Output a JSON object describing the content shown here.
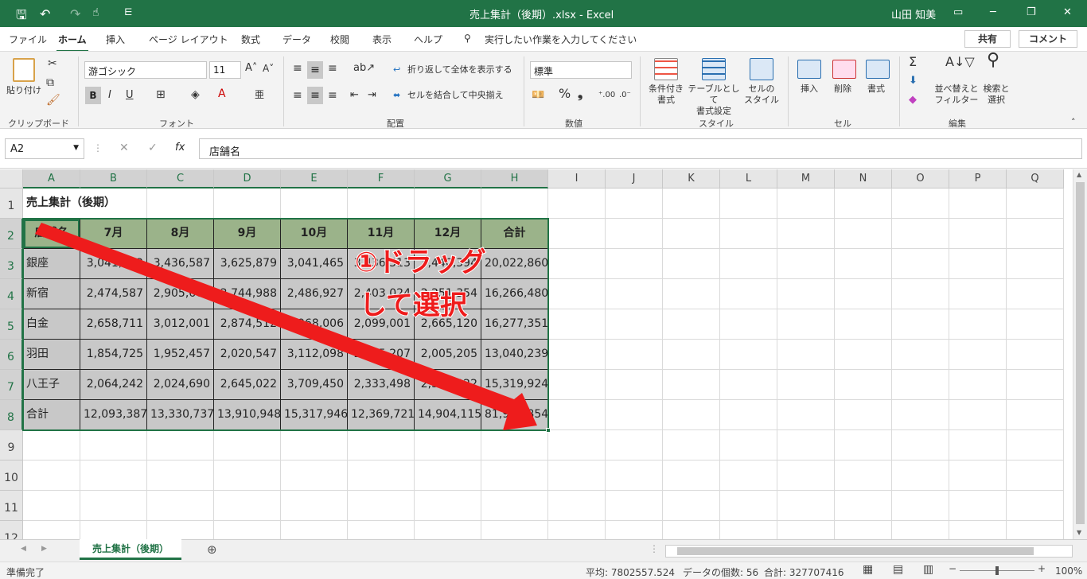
{
  "title_bar": {
    "title": "売上集計（後期）.xlsx  -  Excel",
    "user": "山田 知美"
  },
  "tabs": [
    "ファイル",
    "ホーム",
    "挿入",
    "ページ レイアウト",
    "数式",
    "データ",
    "校閲",
    "表示",
    "ヘルプ"
  ],
  "tell_me": "実行したい作業を入力してください",
  "share": "共有",
  "comment": "コメント",
  "ribbon": {
    "paste": "貼り付け",
    "clipboard": "クリップボード",
    "font_name": "游ゴシック",
    "font_size": "11",
    "font": "フォント",
    "wrap_text": "折り返して全体を表示する",
    "merge_center": "セルを結合して中央揃え",
    "alignment": "配置",
    "number_format": "標準",
    "number": "数値",
    "cond_format": "条件付き\n書式",
    "table_format": "テーブルとして\n書式設定",
    "cell_style": "セルの\nスタイル",
    "styles": "スタイル",
    "insert": "挿入",
    "delete": "削除",
    "format": "書式",
    "cells": "セル",
    "sort_filter": "並べ替えと\nフィルター",
    "find_select": "検索と\n選択",
    "editing": "編集"
  },
  "formula_bar": {
    "name_box": "A2",
    "fx": "fx",
    "content": "店舗名"
  },
  "columns": [
    "A",
    "B",
    "C",
    "D",
    "E",
    "F",
    "G",
    "H",
    "I",
    "J",
    "K",
    "L",
    "M",
    "N",
    "O",
    "P",
    "Q"
  ],
  "rows": [
    "1",
    "2",
    "3",
    "4",
    "5",
    "6",
    "7",
    "8",
    "9",
    "10",
    "11",
    "12"
  ],
  "sheet": {
    "title": "売上集計（後期）",
    "headers": [
      "店舗名",
      "7月",
      "8月",
      "9月",
      "10月",
      "11月",
      "12月",
      "合計"
    ],
    "data": [
      [
        "銀座",
        "3,041,122",
        "3,436,587",
        "3,625,879",
        "3,041,465",
        "3,436,513",
        "3,440,394",
        "20,022,860"
      ],
      [
        "新宿",
        "2,474,587",
        "2,905,600",
        "2,744,988",
        "2,486,927",
        "2,403,024",
        "2,251,354",
        "16,266,480"
      ],
      [
        "白金",
        "2,658,711",
        "3,012,001",
        "2,874,512",
        "2,968,006",
        "2,099,001",
        "2,665,120",
        "16,277,351"
      ],
      [
        "羽田",
        "1,854,725",
        "1,952,457",
        "2,020,547",
        "3,112,098",
        "2,095,207",
        "2,005,205",
        "13,040,239"
      ],
      [
        "八王子",
        "2,064,242",
        "2,024,690",
        "2,645,022",
        "3,709,450",
        "2,333,498",
        "2,543,022",
        "15,319,924"
      ],
      [
        "合計",
        "12,093,387",
        "13,330,737",
        "13,910,948",
        "15,317,946",
        "12,369,721",
        "14,904,115",
        "81,926,854"
      ]
    ]
  },
  "annotation": {
    "line1": "①ドラッグ",
    "line2": "して選択",
    "color": "#ee1c1c"
  },
  "sheet_tab": "売上集計（後期）",
  "status_bar": {
    "ready": "準備完了",
    "average": "平均: 7802557.524",
    "count": "データの個数: 56",
    "sum": "合計: 327707416",
    "zoom": "100%"
  },
  "colors": {
    "excel_green": "#217346",
    "header_fill": "#9bb38a",
    "selection_fill": "#c8c8c8"
  }
}
